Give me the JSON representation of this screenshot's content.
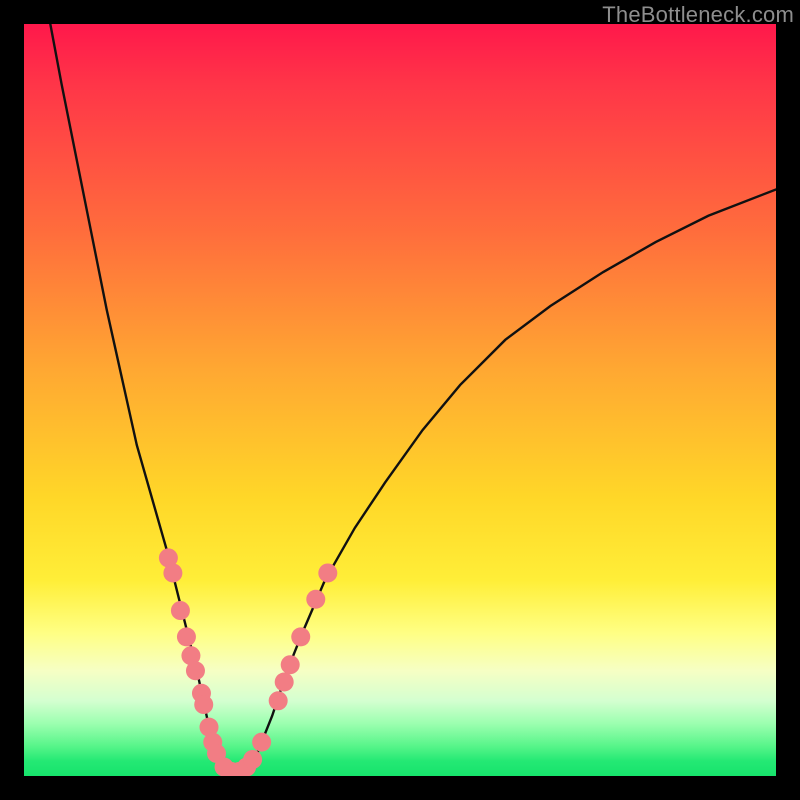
{
  "watermark": "TheBottleneck.com",
  "chart_data": {
    "type": "line",
    "title": "",
    "xlabel": "",
    "ylabel": "",
    "xlim": [
      0,
      100
    ],
    "ylim": [
      0,
      100
    ],
    "grid": false,
    "notes": "V-shaped bottleneck curve on a rainbow heat gradient. Axes are unlabeled/no ticks; x/y are normalized 0–100. Trough ≈ x 25–30, y ≈ 0. Pink dots mark sample points along the curve near the lower portion.",
    "curve": [
      {
        "x": 3.5,
        "y": 100
      },
      {
        "x": 5,
        "y": 92
      },
      {
        "x": 7,
        "y": 82
      },
      {
        "x": 9,
        "y": 72
      },
      {
        "x": 11,
        "y": 62
      },
      {
        "x": 13,
        "y": 53
      },
      {
        "x": 15,
        "y": 44
      },
      {
        "x": 17,
        "y": 37
      },
      {
        "x": 19,
        "y": 30
      },
      {
        "x": 21,
        "y": 22
      },
      {
        "x": 23,
        "y": 14
      },
      {
        "x": 24.5,
        "y": 7
      },
      {
        "x": 25.5,
        "y": 3
      },
      {
        "x": 26.5,
        "y": 1
      },
      {
        "x": 28,
        "y": 0.4
      },
      {
        "x": 29.5,
        "y": 1
      },
      {
        "x": 31,
        "y": 3
      },
      {
        "x": 33,
        "y": 8
      },
      {
        "x": 35,
        "y": 14
      },
      {
        "x": 37,
        "y": 19
      },
      {
        "x": 40,
        "y": 26
      },
      {
        "x": 44,
        "y": 33
      },
      {
        "x": 48,
        "y": 39
      },
      {
        "x": 53,
        "y": 46
      },
      {
        "x": 58,
        "y": 52
      },
      {
        "x": 64,
        "y": 58
      },
      {
        "x": 70,
        "y": 62.5
      },
      {
        "x": 77,
        "y": 67
      },
      {
        "x": 84,
        "y": 71
      },
      {
        "x": 91,
        "y": 74.5
      },
      {
        "x": 100,
        "y": 78
      }
    ],
    "dots": [
      {
        "x": 19.2,
        "y": 29
      },
      {
        "x": 19.8,
        "y": 27
      },
      {
        "x": 20.8,
        "y": 22
      },
      {
        "x": 21.6,
        "y": 18.5
      },
      {
        "x": 22.2,
        "y": 16
      },
      {
        "x": 22.8,
        "y": 14
      },
      {
        "x": 23.6,
        "y": 11
      },
      {
        "x": 23.9,
        "y": 9.5
      },
      {
        "x": 24.6,
        "y": 6.5
      },
      {
        "x": 25.1,
        "y": 4.5
      },
      {
        "x": 25.6,
        "y": 3
      },
      {
        "x": 26.6,
        "y": 1.2
      },
      {
        "x": 27.6,
        "y": 0.6
      },
      {
        "x": 28.6,
        "y": 0.6
      },
      {
        "x": 29.6,
        "y": 1.2
      },
      {
        "x": 30.4,
        "y": 2.2
      },
      {
        "x": 31.6,
        "y": 4.5
      },
      {
        "x": 33.8,
        "y": 10
      },
      {
        "x": 34.6,
        "y": 12.5
      },
      {
        "x": 35.4,
        "y": 14.8
      },
      {
        "x": 36.8,
        "y": 18.5
      },
      {
        "x": 38.8,
        "y": 23.5
      },
      {
        "x": 40.4,
        "y": 27
      }
    ],
    "colors": {
      "curve": "#111111",
      "dot_fill": "#f27d84",
      "dot_stroke": "#f27d84",
      "gradient_top": "#ff184b",
      "gradient_bottom": "#17e36c"
    }
  }
}
